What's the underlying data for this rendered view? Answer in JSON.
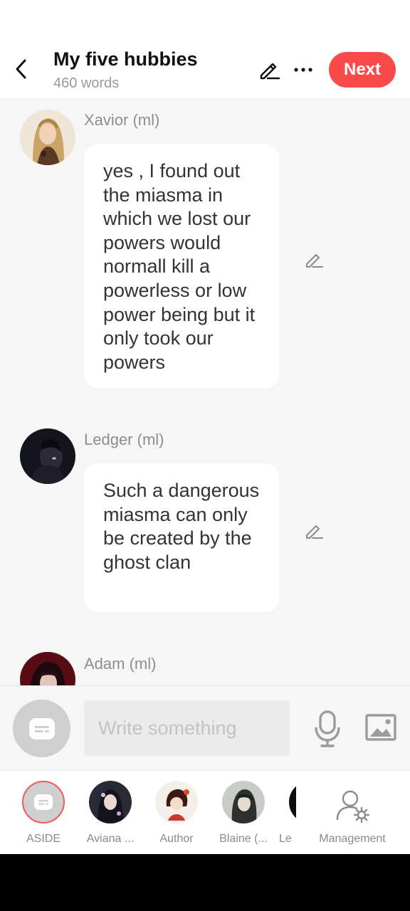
{
  "header": {
    "title": "My five hubbies",
    "word_count": "460 words",
    "next_label": "Next"
  },
  "messages": [
    {
      "sender": "Xavior (ml)",
      "text": "yes , I found out the miasma in which we lost our powers would normall kill a powerless or low power being but it only took our powers"
    },
    {
      "sender": "Ledger (ml)",
      "text": "Such a dangerous miasma can only be created by the ghost clan"
    },
    {
      "sender": "Adam (ml)",
      "text": ""
    }
  ],
  "composer": {
    "placeholder": "Write something"
  },
  "characters": [
    {
      "label": "ASIDE"
    },
    {
      "label": "Aviana ..."
    },
    {
      "label": "Author"
    },
    {
      "label": "Blaine (..."
    },
    {
      "label": "Le"
    }
  ],
  "management_label": "Management",
  "colors": {
    "accent": "#fb4a4c",
    "background": "#f6f6f6",
    "bubble": "#ffffff"
  }
}
